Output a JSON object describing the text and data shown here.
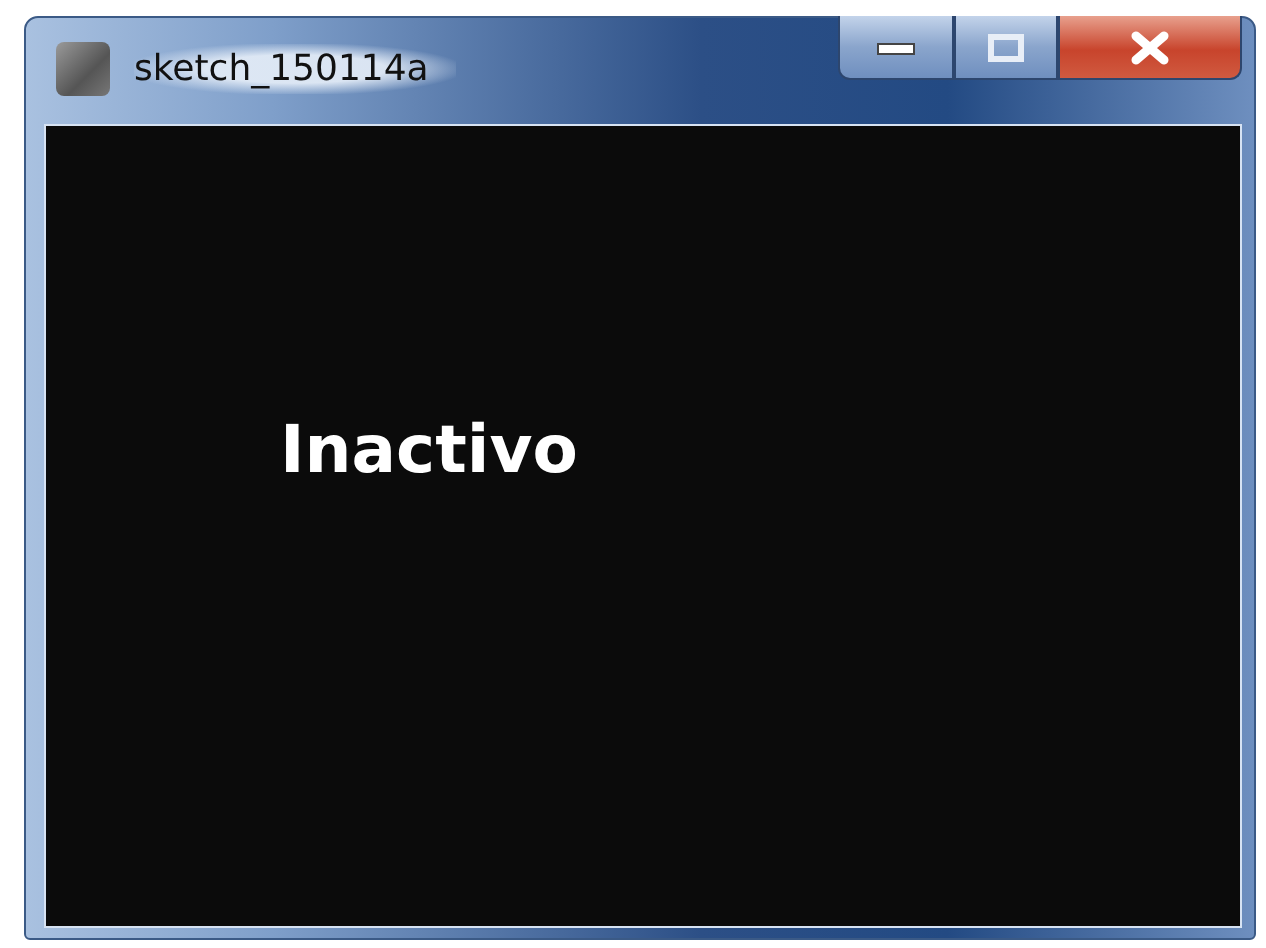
{
  "window": {
    "title": "sketch_150114a"
  },
  "title_buttons": [
    {
      "kind": "minimize"
    },
    {
      "kind": "maximize"
    },
    {
      "kind": "close"
    }
  ],
  "canvas": {
    "text": "Inactivo"
  }
}
